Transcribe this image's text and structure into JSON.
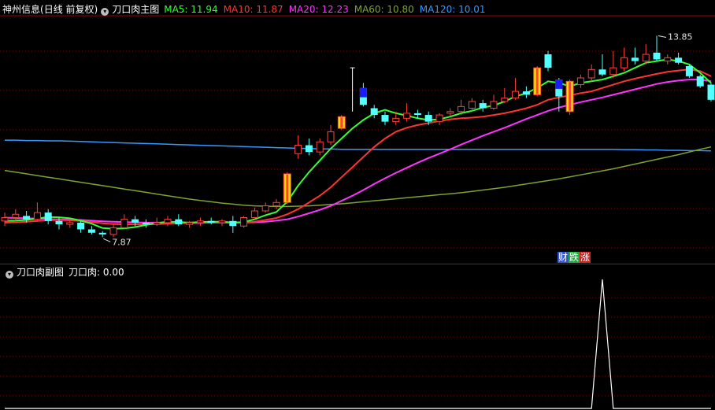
{
  "main_panel": {
    "stock_name": "神州信息",
    "period": "(日线 前复权)",
    "indicator_name": "刀口肉主图",
    "ma_items": [
      {
        "label": "MA5: 11.94",
        "color": "#33ff33"
      },
      {
        "label": "MA10: 11.87",
        "color": "#ff3333"
      },
      {
        "label": "MA20: 12.23",
        "color": "#ff33ff"
      },
      {
        "label": "MA60: 10.80",
        "color": "#7fa32e"
      },
      {
        "label": "MA120: 10.01",
        "color": "#3399ff"
      }
    ],
    "high_label": "13.85",
    "low_label": "7.87",
    "signal_chars": [
      {
        "text": "财",
        "color": "#ffffff",
        "bg": "#3355cc"
      },
      {
        "text": "跌",
        "color": "#ffffff",
        "bg": "#22aa44"
      },
      {
        "text": "涨",
        "color": "#ffffff",
        "bg": "#cc2222"
      }
    ]
  },
  "sub_panel": {
    "indicator_name": "刀口肉副图",
    "value_label": "刀口肉: 0.00"
  },
  "colors": {
    "up": "#ff4040",
    "down": "#54ffff",
    "grid": "#800000",
    "special_yellow": "#ffdd00",
    "special_blue": "#1a1aff"
  },
  "chart_data": {
    "type": "candlestick",
    "title": "",
    "price_ylim": [
      7.2,
      14.4
    ],
    "candles": [
      {
        "o": 8.35,
        "c": 8.45,
        "h": 8.6,
        "l": 8.2
      },
      {
        "o": 8.45,
        "c": 8.55,
        "h": 8.7,
        "l": 8.35
      },
      {
        "o": 8.5,
        "c": 8.4,
        "h": 8.65,
        "l": 8.3
      },
      {
        "o": 8.4,
        "c": 8.6,
        "h": 8.9,
        "l": 8.35
      },
      {
        "o": 8.6,
        "c": 8.35,
        "h": 8.7,
        "l": 8.25
      },
      {
        "o": 8.35,
        "c": 8.25,
        "h": 8.45,
        "l": 8.1
      },
      {
        "o": 8.25,
        "c": 8.3,
        "h": 8.4,
        "l": 8.15
      },
      {
        "o": 8.3,
        "c": 8.1,
        "h": 8.35,
        "l": 8.0
      },
      {
        "o": 8.1,
        "c": 8.0,
        "h": 8.2,
        "l": 7.95
      },
      {
        "o": 8.0,
        "c": 7.95,
        "h": 8.05,
        "l": 7.87
      },
      {
        "o": 7.95,
        "c": 8.15,
        "h": 8.25,
        "l": 7.87
      },
      {
        "o": 8.15,
        "c": 8.4,
        "h": 8.55,
        "l": 8.1
      },
      {
        "o": 8.4,
        "c": 8.3,
        "h": 8.5,
        "l": 8.2
      },
      {
        "o": 8.3,
        "c": 8.25,
        "h": 8.4,
        "l": 8.15
      },
      {
        "o": 8.25,
        "c": 8.3,
        "h": 8.45,
        "l": 8.2
      },
      {
        "o": 8.3,
        "c": 8.4,
        "h": 8.5,
        "l": 8.2
      },
      {
        "o": 8.4,
        "c": 8.25,
        "h": 8.55,
        "l": 8.2
      },
      {
        "o": 8.25,
        "c": 8.3,
        "h": 8.35,
        "l": 8.15
      },
      {
        "o": 8.3,
        "c": 8.35,
        "h": 8.45,
        "l": 8.2
      },
      {
        "o": 8.35,
        "c": 8.3,
        "h": 8.45,
        "l": 8.25
      },
      {
        "o": 8.3,
        "c": 8.35,
        "h": 8.4,
        "l": 8.2
      },
      {
        "o": 8.35,
        "c": 8.2,
        "h": 8.5,
        "l": 8.0
      },
      {
        "o": 8.2,
        "c": 8.45,
        "h": 8.5,
        "l": 8.15
      },
      {
        "o": 8.45,
        "c": 8.65,
        "h": 8.75,
        "l": 8.4
      },
      {
        "o": 8.65,
        "c": 8.8,
        "h": 8.9,
        "l": 8.6
      },
      {
        "o": 8.8,
        "c": 8.9,
        "h": 9.0,
        "l": 8.7
      },
      {
        "o": 8.9,
        "c": 9.75,
        "h": 9.8,
        "l": 8.85,
        "special": "yellow"
      },
      {
        "o": 10.35,
        "c": 10.6,
        "h": 10.9,
        "l": 10.2
      },
      {
        "o": 10.6,
        "c": 10.4,
        "h": 10.8,
        "l": 10.3
      },
      {
        "o": 10.4,
        "c": 10.7,
        "h": 10.8,
        "l": 10.3
      },
      {
        "o": 10.7,
        "c": 11.0,
        "h": 11.2,
        "l": 10.6
      },
      {
        "o": 11.1,
        "c": 11.45,
        "h": 11.5,
        "l": 11.05,
        "special": "yellow"
      },
      {
        "o": 11.6,
        "c": 12.2,
        "h": 12.9,
        "l": 11.6,
        "special": "stub"
      },
      {
        "o": 12.3,
        "c": 11.8,
        "h": 12.45,
        "l": 11.75,
        "special": "blue"
      },
      {
        "o": 11.7,
        "c": 11.5,
        "h": 11.8,
        "l": 11.4
      },
      {
        "o": 11.5,
        "c": 11.3,
        "h": 11.6,
        "l": 11.2
      },
      {
        "o": 11.3,
        "c": 11.4,
        "h": 11.6,
        "l": 11.2
      },
      {
        "o": 11.4,
        "c": 11.55,
        "h": 11.85,
        "l": 11.3
      },
      {
        "o": 11.55,
        "c": 11.5,
        "h": 11.65,
        "l": 11.4
      },
      {
        "o": 11.5,
        "c": 11.3,
        "h": 11.6,
        "l": 11.2
      },
      {
        "o": 11.3,
        "c": 11.5,
        "h": 11.55,
        "l": 11.2
      },
      {
        "o": 11.55,
        "c": 11.6,
        "h": 11.7,
        "l": 11.45
      },
      {
        "o": 11.6,
        "c": 11.75,
        "h": 11.95,
        "l": 11.5
      },
      {
        "o": 11.7,
        "c": 11.9,
        "h": 12.0,
        "l": 11.6
      },
      {
        "o": 11.85,
        "c": 11.7,
        "h": 11.95,
        "l": 11.6
      },
      {
        "o": 11.7,
        "c": 11.9,
        "h": 12.1,
        "l": 11.65
      },
      {
        "o": 11.9,
        "c": 12.0,
        "h": 12.3,
        "l": 11.85
      },
      {
        "o": 12.0,
        "c": 12.2,
        "h": 12.6,
        "l": 11.95
      },
      {
        "o": 12.2,
        "c": 12.1,
        "h": 12.35,
        "l": 12.0
      },
      {
        "o": 12.1,
        "c": 12.9,
        "h": 12.95,
        "l": 12.05,
        "special": "yellow"
      },
      {
        "o": 13.3,
        "c": 12.9,
        "h": 13.4,
        "l": 12.8
      },
      {
        "o": 12.55,
        "c": 12.05,
        "h": 12.6,
        "l": 11.6,
        "special": "blue"
      },
      {
        "o": 11.6,
        "c": 12.5,
        "h": 12.55,
        "l": 11.5,
        "special": "yellow"
      },
      {
        "o": 12.4,
        "c": 12.6,
        "h": 12.7,
        "l": 12.3
      },
      {
        "o": 12.6,
        "c": 12.85,
        "h": 13.0,
        "l": 12.5
      },
      {
        "o": 12.85,
        "c": 12.7,
        "h": 13.3,
        "l": 12.65
      },
      {
        "o": 12.7,
        "c": 12.9,
        "h": 13.4,
        "l": 12.6
      },
      {
        "o": 12.9,
        "c": 13.2,
        "h": 13.5,
        "l": 12.8
      },
      {
        "o": 13.2,
        "c": 13.1,
        "h": 13.5,
        "l": 13.0
      },
      {
        "o": 13.1,
        "c": 13.3,
        "h": 13.6,
        "l": 13.0
      },
      {
        "o": 13.35,
        "c": 13.15,
        "h": 13.85,
        "l": 13.1
      },
      {
        "o": 13.1,
        "c": 13.2,
        "h": 13.3,
        "l": 13.0
      },
      {
        "o": 13.2,
        "c": 13.05,
        "h": 13.35,
        "l": 13.0
      },
      {
        "o": 12.95,
        "c": 12.65,
        "h": 13.0,
        "l": 12.6
      },
      {
        "o": 12.65,
        "c": 12.35,
        "h": 12.7,
        "l": 12.3
      },
      {
        "o": 12.4,
        "c": 11.95,
        "h": 12.45,
        "l": 11.9
      }
    ],
    "series": [
      {
        "name": "MA5",
        "color": "#33ff33",
        "values": [
          8.35,
          8.36,
          8.38,
          8.42,
          8.47,
          8.46,
          8.43,
          8.36,
          8.27,
          8.14,
          8.12,
          8.13,
          8.17,
          8.23,
          8.29,
          8.33,
          8.32,
          8.3,
          8.32,
          8.33,
          8.33,
          8.3,
          8.32,
          8.4,
          8.52,
          8.62,
          8.92,
          9.4,
          9.8,
          10.15,
          10.5,
          10.8,
          11.1,
          11.35,
          11.55,
          11.65,
          11.55,
          11.48,
          11.4,
          11.35,
          11.37,
          11.45,
          11.55,
          11.62,
          11.72,
          11.78,
          11.9,
          12.05,
          12.15,
          12.3,
          12.5,
          12.45,
          12.35,
          12.45,
          12.5,
          12.55,
          12.65,
          12.75,
          12.9,
          13.05,
          13.1,
          13.15,
          13.1,
          13.0,
          12.75,
          12.45
        ]
      },
      {
        "name": "MA10",
        "color": "#ff3333",
        "values": [
          8.3,
          8.31,
          8.33,
          8.35,
          8.37,
          8.38,
          8.37,
          8.35,
          8.32,
          8.28,
          8.26,
          8.25,
          8.25,
          8.25,
          8.26,
          8.27,
          8.28,
          8.29,
          8.3,
          8.31,
          8.32,
          8.31,
          8.31,
          8.33,
          8.38,
          8.44,
          8.55,
          8.7,
          8.9,
          9.1,
          9.35,
          9.65,
          9.95,
          10.25,
          10.55,
          10.8,
          11.0,
          11.12,
          11.2,
          11.26,
          11.32,
          11.37,
          11.4,
          11.42,
          11.45,
          11.5,
          11.55,
          11.62,
          11.7,
          11.8,
          11.95,
          12.02,
          12.08,
          12.15,
          12.2,
          12.3,
          12.4,
          12.5,
          12.58,
          12.65,
          12.72,
          12.78,
          12.82,
          12.85,
          12.8,
          12.65
        ]
      },
      {
        "name": "MA20",
        "color": "#ff33ff",
        "values": [
          8.45,
          8.44,
          8.43,
          8.42,
          8.41,
          8.4,
          8.39,
          8.38,
          8.36,
          8.34,
          8.33,
          8.32,
          8.31,
          8.3,
          8.3,
          8.3,
          8.29,
          8.29,
          8.29,
          8.3,
          8.3,
          8.3,
          8.3,
          8.31,
          8.33,
          8.36,
          8.4,
          8.48,
          8.58,
          8.68,
          8.8,
          8.95,
          9.1,
          9.27,
          9.45,
          9.62,
          9.78,
          9.93,
          10.08,
          10.22,
          10.35,
          10.48,
          10.62,
          10.75,
          10.88,
          11.0,
          11.12,
          11.25,
          11.38,
          11.5,
          11.62,
          11.72,
          11.8,
          11.88,
          11.95,
          12.02,
          12.1,
          12.18,
          12.26,
          12.34,
          12.42,
          12.48,
          12.52,
          12.55,
          12.55,
          12.5
        ]
      },
      {
        "name": "MA60",
        "color": "#7fa32e",
        "values": [
          9.85,
          9.8,
          9.75,
          9.7,
          9.65,
          9.6,
          9.55,
          9.5,
          9.45,
          9.4,
          9.35,
          9.3,
          9.25,
          9.2,
          9.15,
          9.1,
          9.05,
          9.0,
          8.96,
          8.92,
          8.88,
          8.85,
          8.82,
          8.8,
          8.79,
          8.78,
          8.78,
          8.79,
          8.8,
          8.82,
          8.84,
          8.86,
          8.89,
          8.92,
          8.95,
          8.98,
          9.01,
          9.04,
          9.07,
          9.1,
          9.13,
          9.16,
          9.19,
          9.23,
          9.27,
          9.31,
          9.35,
          9.4,
          9.45,
          9.5,
          9.55,
          9.6,
          9.66,
          9.72,
          9.78,
          9.84,
          9.9,
          9.97,
          10.04,
          10.11,
          10.18,
          10.25,
          10.32,
          10.4,
          10.48,
          10.55
        ]
      },
      {
        "name": "MA120",
        "color": "#3399ff",
        "values": [
          10.75,
          10.75,
          10.74,
          10.74,
          10.73,
          10.73,
          10.72,
          10.71,
          10.7,
          10.69,
          10.68,
          10.67,
          10.66,
          10.65,
          10.64,
          10.63,
          10.62,
          10.61,
          10.6,
          10.59,
          10.58,
          10.57,
          10.56,
          10.55,
          10.54,
          10.53,
          10.52,
          10.51,
          10.5,
          10.49,
          10.49,
          10.48,
          10.48,
          10.48,
          10.48,
          10.48,
          10.48,
          10.48,
          10.48,
          10.48,
          10.48,
          10.48,
          10.48,
          10.48,
          10.48,
          10.48,
          10.48,
          10.48,
          10.48,
          10.48,
          10.48,
          10.48,
          10.48,
          10.48,
          10.48,
          10.48,
          10.48,
          10.47,
          10.47,
          10.46,
          10.46,
          10.45,
          10.45,
          10.44,
          10.44,
          10.43
        ]
      }
    ],
    "sub_values": [
      0,
      0,
      0,
      0,
      0,
      0,
      0,
      0,
      0,
      0,
      0,
      0,
      0,
      0,
      0,
      0,
      0,
      0,
      0,
      0,
      0,
      0,
      0,
      0,
      0,
      0,
      0,
      0,
      0,
      0,
      0,
      0,
      0,
      0,
      0,
      0,
      0,
      0,
      0,
      0,
      0,
      0,
      0,
      0,
      0,
      0,
      0,
      0,
      0,
      0,
      0,
      0,
      0,
      0,
      0,
      1,
      0,
      0,
      0,
      0,
      0,
      0,
      0,
      0,
      0,
      0
    ],
    "sub_ylim": [
      0,
      1
    ]
  }
}
